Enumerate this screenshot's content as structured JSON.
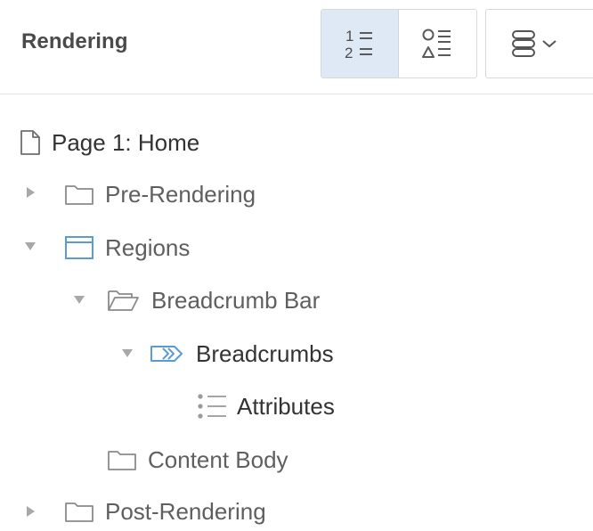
{
  "header": {
    "title": "Rendering",
    "view_buttons": [
      {
        "name": "ordered-list",
        "glyph_top": "1",
        "glyph_bottom": "2",
        "active": true
      },
      {
        "name": "shape-list",
        "active": false
      }
    ]
  },
  "colors": {
    "accent": "#5b9bd5",
    "active_bg": "#dfe9f6",
    "icon_gray": "#9a9a9a",
    "text": "#505050"
  },
  "tree": {
    "page": {
      "label": "Page 1: Home"
    },
    "pre_rendering": {
      "label": "Pre-Rendering",
      "expanded": false
    },
    "regions": {
      "label": "Regions",
      "expanded": true
    },
    "breadcrumb_bar": {
      "label": "Breadcrumb Bar",
      "expanded": true
    },
    "breadcrumbs": {
      "label": "Breadcrumbs",
      "expanded": true
    },
    "attributes": {
      "label": "Attributes"
    },
    "content_body": {
      "label": "Content Body"
    },
    "post_rendering": {
      "label": "Post-Rendering",
      "expanded": false
    }
  }
}
